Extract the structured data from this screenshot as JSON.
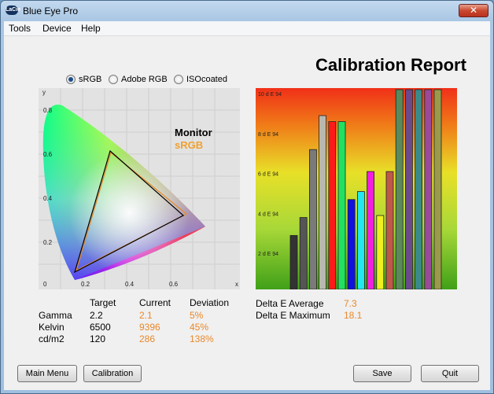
{
  "window": {
    "title": "Blue Eye Pro",
    "app_icon": "lacie-logo-icon",
    "close_glyph": "✕"
  },
  "menu": [
    "Tools",
    "Device",
    "Help"
  ],
  "report_title": "Calibration Report",
  "color_space": {
    "options": [
      "sRGB",
      "Adobe RGB",
      "ISOcoated"
    ],
    "selected": "sRGB"
  },
  "cie_chart": {
    "x_label": "x",
    "y_label": "y",
    "x_ticks": [
      "0",
      "0.2",
      "0.4",
      "0.6",
      "x"
    ],
    "y_ticks": [
      "0.8",
      "0.6",
      "0.4",
      "0.2",
      "0"
    ],
    "legend_monitor": "Monitor",
    "legend_srgb": "sRGB",
    "legend_monitor_color": "#000000",
    "legend_srgb_color": "#f0a030"
  },
  "chart_data": {
    "type": "bar",
    "y_ticks": [
      "10 d E 94",
      "8 d E 94",
      "6 d E 94",
      "4 d E 94",
      "2 d E 94"
    ],
    "ylim": [
      0,
      10
    ],
    "bars": [
      {
        "value": 2.7,
        "color": "#333333"
      },
      {
        "value": 3.6,
        "color": "#555555"
      },
      {
        "value": 7.0,
        "color": "#7a7a7a"
      },
      {
        "value": 8.7,
        "color": "#b8b8b0"
      },
      {
        "value": 8.4,
        "color": "#ff1a1a"
      },
      {
        "value": 8.4,
        "color": "#22e060"
      },
      {
        "value": 4.5,
        "color": "#1010e0"
      },
      {
        "value": 4.9,
        "color": "#22e8f0"
      },
      {
        "value": 5.9,
        "color": "#f020e0"
      },
      {
        "value": 3.7,
        "color": "#f0f020"
      },
      {
        "value": 5.9,
        "color": "#c0584a"
      },
      {
        "value": 10.0,
        "color": "#5a8a5a"
      },
      {
        "value": 10.0,
        "color": "#6a4a8a"
      },
      {
        "value": 10.0,
        "color": "#3a8a8a"
      },
      {
        "value": 10.0,
        "color": "#9a4a9a"
      },
      {
        "value": 10.0,
        "color": "#9a9a4a"
      }
    ]
  },
  "table": {
    "headers": [
      "",
      "Target",
      "Current",
      "Deviation"
    ],
    "rows": [
      {
        "label": "Gamma",
        "target": "2.2",
        "current": "2.1",
        "deviation": "5%"
      },
      {
        "label": "Kelvin",
        "target": "6500",
        "current": "9396",
        "deviation": "45%"
      },
      {
        "label": "cd/m2",
        "target": "120",
        "current": "286",
        "deviation": "138%"
      }
    ]
  },
  "delta": {
    "average_label": "Delta E Average",
    "average_value": "7.3",
    "maximum_label": "Delta E Maximum",
    "maximum_value": "18.1"
  },
  "buttons": {
    "main_menu": "Main Menu",
    "calibration": "Calibration",
    "save": "Save",
    "quit": "Quit"
  }
}
